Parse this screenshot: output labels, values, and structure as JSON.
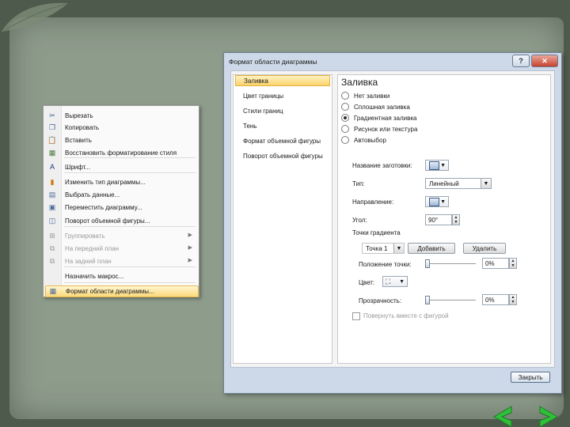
{
  "context_menu": {
    "items": [
      {
        "label": "Вырезать",
        "icon": "scissors-icon",
        "glyph": "✂",
        "color": "#3a5f9a",
        "disabled": false,
        "submenu": false
      },
      {
        "label": "Копировать",
        "icon": "copy-icon",
        "glyph": "❐",
        "color": "#3a5f9a",
        "disabled": false,
        "submenu": false
      },
      {
        "label": "Вставить",
        "icon": "paste-icon",
        "glyph": "📋",
        "color": "#b07a20",
        "disabled": false,
        "submenu": false
      },
      {
        "label": "Восстановить форматирование стиля",
        "icon": "reset-style-icon",
        "glyph": "▦",
        "color": "#4a7a3a",
        "disabled": false,
        "submenu": false
      },
      {
        "label": "Шрифт...",
        "icon": "font-icon",
        "glyph": "A",
        "color": "#1a3a7a",
        "disabled": false,
        "submenu": false
      },
      {
        "label": "Изменить тип диаграммы...",
        "icon": "chart-type-icon",
        "glyph": "▮",
        "color": "#d07a10",
        "disabled": false,
        "submenu": false
      },
      {
        "label": "Выбрать данные...",
        "icon": "select-data-icon",
        "glyph": "▤",
        "color": "#4a6a9a",
        "disabled": false,
        "submenu": false
      },
      {
        "label": "Переместить диаграмму...",
        "icon": "move-chart-icon",
        "glyph": "▣",
        "color": "#4a6a9a",
        "disabled": false,
        "submenu": false
      },
      {
        "label": "Поворот объемной фигуры...",
        "icon": "rotate-3d-icon",
        "glyph": "◫",
        "color": "#4a6a9a",
        "disabled": false,
        "submenu": false
      },
      {
        "label": "Группировать",
        "icon": "group-icon",
        "glyph": "⊞",
        "color": "#9a9a9a",
        "disabled": true,
        "submenu": true
      },
      {
        "label": "На передний план",
        "icon": "bring-front-icon",
        "glyph": "⧉",
        "color": "#9a9a9a",
        "disabled": true,
        "submenu": true
      },
      {
        "label": "На задний план",
        "icon": "send-back-icon",
        "glyph": "⧉",
        "color": "#9a9a9a",
        "disabled": true,
        "submenu": true
      },
      {
        "label": "Назначить макрос...",
        "icon": "macro-icon",
        "glyph": "",
        "color": "#9a9a9a",
        "disabled": false,
        "submenu": false
      },
      {
        "label": "Формат области диаграммы...",
        "icon": "format-area-icon",
        "glyph": "▦",
        "color": "#4a6a9a",
        "disabled": false,
        "submenu": false,
        "highlighted": true
      }
    ]
  },
  "dialog": {
    "title": "Формат области диаграммы",
    "help_glyph": "?",
    "close_glyph": "✕",
    "nav": [
      "Заливка",
      "Цвет границы",
      "Стили границ",
      "Тень",
      "Формат объемной фигуры",
      "Поворот объемной фигуры"
    ],
    "panel": {
      "title": "Заливка",
      "fill_options": [
        {
          "label": "Нет заливки",
          "checked": false
        },
        {
          "label": "Сплошная заливка",
          "checked": false
        },
        {
          "label": "Градиентная заливка",
          "checked": true
        },
        {
          "label": "Рисунок или текстура",
          "checked": false
        },
        {
          "label": "Автовыбор",
          "checked": false
        }
      ],
      "preset_label": "Название заготовки:",
      "type_label": "Тип:",
      "type_value": "Линейный",
      "direction_label": "Направление:",
      "angle_label": "Угол:",
      "angle_value": "90°",
      "stops_label": "Точки градиента",
      "stop_value": "Точка 1",
      "add_label": "Добавить",
      "remove_label": "Удалить",
      "stop_position_label": "Положение точки:",
      "stop_position_value": "0%",
      "stop_position_level": 0,
      "color_label": "Цвет:",
      "transparency_label": "Прозрачность:",
      "transparency_value": "0%",
      "transparency_level": 0,
      "rotate_with_shape_label": "Повернуть вместе с фигурой",
      "rotate_with_shape_checked": false
    },
    "close_label": "Закрыть"
  },
  "colors": {
    "highlight": "#fbd97a",
    "dialog_frame": "#cdd9e8",
    "arrow_green": "#2fbf3a"
  }
}
